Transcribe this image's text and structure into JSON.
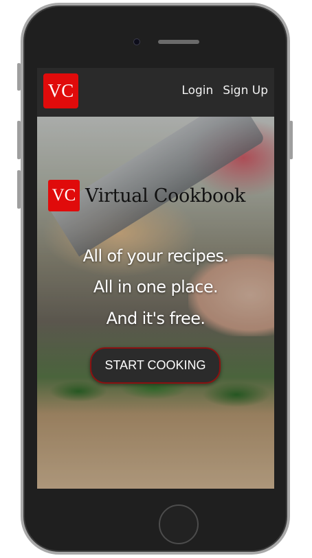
{
  "device": {
    "frame_color": "#1f1f1f",
    "bezel_color": "#a9a9a9"
  },
  "navbar": {
    "logo_text": "VC",
    "logo_color": "#e00b0b",
    "links": [
      {
        "label": "Login"
      },
      {
        "label": "Sign Up"
      }
    ]
  },
  "hero": {
    "brand": {
      "badge_text": "VC",
      "title": "Virtual Cookbook"
    },
    "taglines": [
      "All of your recipes.",
      "All in one place.",
      "And it's free."
    ],
    "cta_label": "START COOKING",
    "cta_border_color": "#8b1111"
  }
}
